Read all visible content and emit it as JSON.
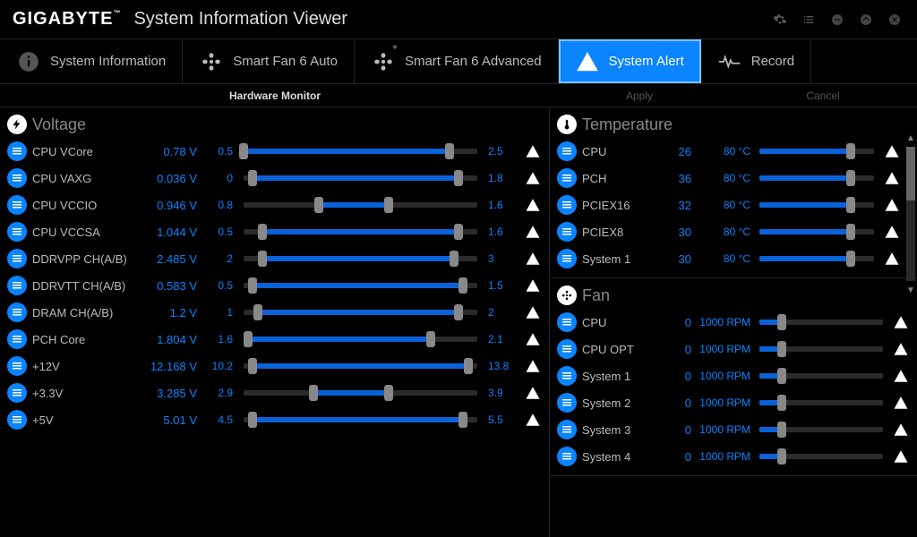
{
  "app": {
    "brand": "GIGABYTE",
    "title": "System Information Viewer"
  },
  "tabs": [
    {
      "label": "System Information"
    },
    {
      "label": "Smart Fan 6 Auto"
    },
    {
      "label": "Smart Fan 6 Advanced"
    },
    {
      "label": "System Alert"
    },
    {
      "label": "Record"
    }
  ],
  "subbar": {
    "hw": "Hardware Monitor",
    "apply": "Apply",
    "cancel": "Cancel"
  },
  "voltage": {
    "title": "Voltage",
    "rows": [
      {
        "name": "CPU VCore",
        "val": "0.78 V",
        "min": "0.5",
        "max": "2.5",
        "lo": 0,
        "hi": 88
      },
      {
        "name": "CPU VAXG",
        "val": "0.036 V",
        "min": "0",
        "max": "1.8",
        "lo": 4,
        "hi": 92
      },
      {
        "name": "CPU VCCIO",
        "val": "0.946 V",
        "min": "0.8",
        "max": "1.6",
        "lo": 32,
        "hi": 62
      },
      {
        "name": "CPU VCCSA",
        "val": "1.044 V",
        "min": "0.5",
        "max": "1.6",
        "lo": 8,
        "hi": 92
      },
      {
        "name": "DDRVPP CH(A/B)",
        "val": "2.485 V",
        "min": "2",
        "max": "3",
        "lo": 8,
        "hi": 90
      },
      {
        "name": "DDRVTT CH(A/B)",
        "val": "0.583 V",
        "min": "0.5",
        "max": "1.5",
        "lo": 4,
        "hi": 94
      },
      {
        "name": "DRAM CH(A/B)",
        "val": "1.2 V",
        "min": "1",
        "max": "2",
        "lo": 6,
        "hi": 92
      },
      {
        "name": "PCH Core",
        "val": "1.804 V",
        "min": "1.6",
        "max": "2.1",
        "lo": 2,
        "hi": 80
      },
      {
        "name": "+12V",
        "val": "12.168 V",
        "min": "10.2",
        "max": "13.8",
        "lo": 4,
        "hi": 96
      },
      {
        "name": "+3.3V",
        "val": "3.285 V",
        "min": "2.9",
        "max": "3.9",
        "lo": 30,
        "hi": 62
      },
      {
        "name": "+5V",
        "val": "5.01 V",
        "min": "4.5",
        "max": "5.5",
        "lo": 4,
        "hi": 94
      }
    ]
  },
  "temperature": {
    "title": "Temperature",
    "rows": [
      {
        "name": "CPU",
        "val": "26",
        "thresh": "80 °C",
        "pos": 80
      },
      {
        "name": "PCH",
        "val": "36",
        "thresh": "80 °C",
        "pos": 80
      },
      {
        "name": "PCIEX16",
        "val": "32",
        "thresh": "80 °C",
        "pos": 80
      },
      {
        "name": "PCIEX8",
        "val": "30",
        "thresh": "80 °C",
        "pos": 80
      },
      {
        "name": "System 1",
        "val": "30",
        "thresh": "80 °C",
        "pos": 80
      }
    ]
  },
  "fan": {
    "title": "Fan",
    "rows": [
      {
        "name": "CPU",
        "val": "0",
        "thresh": "1000 RPM",
        "pos": 18
      },
      {
        "name": "CPU OPT",
        "val": "0",
        "thresh": "1000 RPM",
        "pos": 18
      },
      {
        "name": "System 1",
        "val": "0",
        "thresh": "1000 RPM",
        "pos": 18
      },
      {
        "name": "System 2",
        "val": "0",
        "thresh": "1000 RPM",
        "pos": 18
      },
      {
        "name": "System 3",
        "val": "0",
        "thresh": "1000 RPM",
        "pos": 18
      },
      {
        "name": "System 4",
        "val": "0",
        "thresh": "1000 RPM",
        "pos": 18
      }
    ]
  }
}
